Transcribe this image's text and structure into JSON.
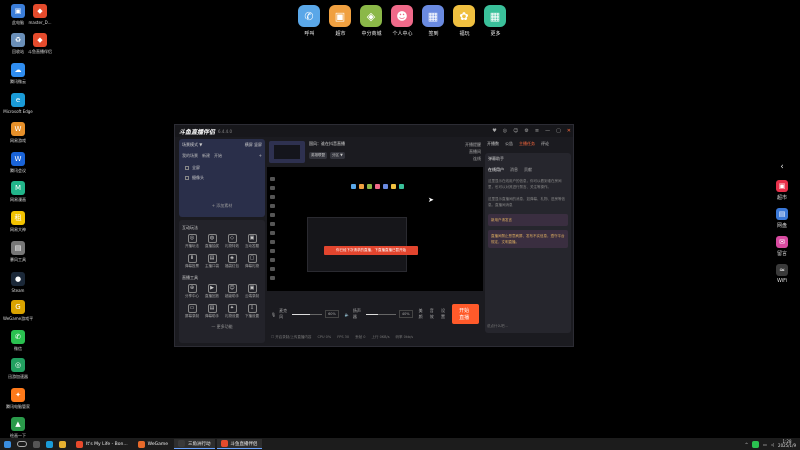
{
  "desktop_icons": [
    {
      "label": "此电脑",
      "color": "#3b7dd8",
      "glyph": "▣"
    },
    {
      "label": "master_D...",
      "color": "#e54b2c",
      "glyph": "◆"
    },
    {
      "label": "回收站",
      "color": "#6a8fb8",
      "glyph": "♻"
    },
    {
      "label": "斗鱼直播伴侣",
      "color": "#e54b2c",
      "glyph": "◆"
    },
    {
      "label": "腾讯微云",
      "color": "#2f8df0",
      "glyph": "☁"
    },
    {
      "label": "Microsoft Edge",
      "color": "#1a9bd7",
      "glyph": "e"
    },
    {
      "label": "网易游戏",
      "color": "#e6902a",
      "glyph": "W"
    },
    {
      "label": "腾讯会议",
      "color": "#1a64d8",
      "glyph": "W"
    },
    {
      "label": "网易漫画",
      "color": "#22b58a",
      "glyph": "M"
    },
    {
      "label": "网易大神",
      "color": "#f2c200",
      "glyph": "租"
    },
    {
      "label": "暴风工具",
      "color": "#777777",
      "glyph": "▤"
    },
    {
      "label": "Steam",
      "color": "#1b2838",
      "glyph": "●"
    },
    {
      "label": "WeGame游戏平台",
      "color": "#d9a300",
      "glyph": "G"
    },
    {
      "label": "微信",
      "color": "#2ac150",
      "glyph": "✆"
    },
    {
      "label": "迅游加速器",
      "color": "#22a060",
      "glyph": "◎"
    },
    {
      "label": "腾讯电脑管家",
      "color": "#ff7a1a",
      "glyph": "✦"
    },
    {
      "label": "绘画一下",
      "color": "#2a9a4a",
      "glyph": "▲"
    }
  ],
  "dock": [
    {
      "label": "呼叫",
      "color": "#5aa7e8",
      "glyph": "✆"
    },
    {
      "label": "超市",
      "color": "#f0a040",
      "glyph": "▣"
    },
    {
      "label": "中分商城",
      "color": "#8bb848",
      "glyph": "◈"
    },
    {
      "label": "个人中心",
      "color": "#f06a8a",
      "glyph": "☻"
    },
    {
      "label": "签到",
      "color": "#6a8ae0",
      "glyph": "▦"
    },
    {
      "label": "福玩",
      "color": "#f0c040",
      "glyph": "✿"
    },
    {
      "label": "更多",
      "color": "#3ac09a",
      "glyph": "▦"
    }
  ],
  "right_sidebar": [
    {
      "label": "超市",
      "color": "#e8304a",
      "glyph": "▣"
    },
    {
      "label": "网盘",
      "color": "#3a78d8",
      "glyph": "▤"
    },
    {
      "label": "留言",
      "color": "#d84aa0",
      "glyph": "✉"
    },
    {
      "label": "WiFi",
      "color": "#3a3a3a",
      "glyph": "≈"
    }
  ],
  "app": {
    "logo": "斗鱼直播伴侣",
    "version": "6.4.4.0",
    "title_controls": [
      "♥",
      "◎",
      "☺",
      "⚙",
      "≡",
      "—",
      "▢",
      "✕"
    ],
    "scene": {
      "header": "场景模式 ▼",
      "header_right": "横屏  竖屏",
      "tabs": [
        "我的场景",
        "新建",
        "开始"
      ],
      "items": [
        "全屏",
        "摄像头"
      ],
      "add_source": "+ 添加素材"
    },
    "interaction": {
      "title": "互动玩法",
      "tools": [
        {
          "label": "开播玩法",
          "glyph": "◎"
        },
        {
          "label": "直播抽奖",
          "glyph": "◍"
        },
        {
          "label": "礼物特效",
          "glyph": "◇"
        },
        {
          "label": "互动答题",
          "glyph": "▣"
        },
        {
          "label": "弹幕投票",
          "glyph": "⬇"
        },
        {
          "label": "主播口袋",
          "glyph": "▤"
        },
        {
          "label": "福袋红包",
          "glyph": "◈"
        },
        {
          "label": "弹幕礼物",
          "glyph": "▢"
        }
      ]
    },
    "live_tools": {
      "title": "直播工具",
      "tools": [
        {
          "label": "分享中心",
          "glyph": "⊕"
        },
        {
          "label": "直播回放",
          "glyph": "▶"
        },
        {
          "label": "超级助手",
          "glyph": "☺"
        },
        {
          "label": "云端录制",
          "glyph": "▣"
        },
        {
          "label": "屏幕录制",
          "glyph": "▭"
        },
        {
          "label": "弹幕助手",
          "glyph": "▤"
        },
        {
          "label": "礼物设置",
          "glyph": "✦"
        },
        {
          "label": "下播设置",
          "glyph": "⇩"
        }
      ],
      "more": "— 更多功能"
    },
    "stream": {
      "title": "国风：谁在抖音直播",
      "tags": [
        "英雄联盟",
        "分区 ▼"
      ],
      "side_lines": [
        "开播提醒",
        "直播间",
        "连线"
      ]
    },
    "toast": "你已经下次请求的直播，下直播直播已暂开始",
    "controls": {
      "mic_label": "麦克风",
      "mic_pct": "60%",
      "speaker_label": "扬声器",
      "speaker_pct": "40%",
      "right_labels": [
        "美颜",
        "音效",
        "设置"
      ],
      "start_button": "开始直播"
    },
    "status": [
      "☐ 开启录制/上传直播内容",
      "CPU 0%",
      "FPS 30",
      "丢帧 0",
      "上行 0KB/s",
      "码率 0kb/s"
    ],
    "right_tabs": [
      "开播数",
      "公告",
      "主播任务",
      "评论"
    ],
    "assistant": {
      "title": "弹幕助手",
      "tabs": [
        "在线用户",
        "消息",
        "贡献"
      ],
      "intro": "这里显示在线用户的信息，你可以看到谁在房间里，也可以对其进行禁言、关注等操作。",
      "text2": "这里显示直播间的消息，如弹幕、礼物、进房等信息。直播间消息",
      "msg1": "新用户请发言",
      "msg2": "直播间禁止恶意刷屏、发布不实信息，遵守平台规定，文明直播。",
      "input": "说点什么吧..."
    }
  },
  "taskbar": {
    "tasks": [
      {
        "label": "It's My Life - Bon...",
        "color": "#e84a2c",
        "active": false
      },
      {
        "label": "WeGame",
        "color": "#e86a2a",
        "active": false
      },
      {
        "label": "三角洲行动",
        "color": "#3a3a3a",
        "active": true
      },
      {
        "label": "斗鱼直播伴侣",
        "color": "#e54b2c",
        "active": true
      }
    ],
    "time": "1:28",
    "date": "2025/1/9"
  }
}
